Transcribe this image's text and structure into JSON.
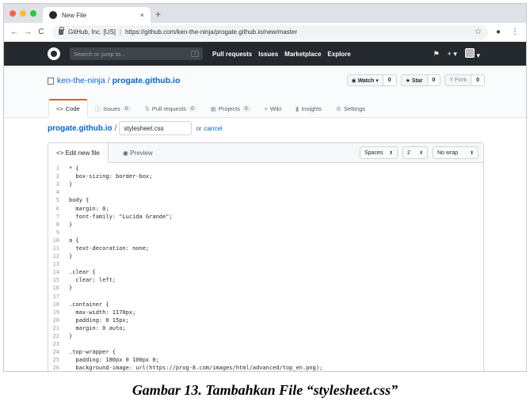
{
  "browser": {
    "tab_title": "New File",
    "tab_close": "×",
    "new_tab": "+",
    "back": "←",
    "forward": "→",
    "reload": "C",
    "ev_cert": "GitHub, Inc. [US]",
    "url": "https://github.com/ken-the-ninja/progate.github.io/new/master",
    "star": "☆",
    "menu": "⋮",
    "account": "●"
  },
  "github_header": {
    "search_placeholder": "Search or jump to...",
    "search_key": "/",
    "nav": [
      "Pull requests",
      "Issues",
      "Marketplace",
      "Explore"
    ],
    "bell": "🔔",
    "plus": "+ ▾",
    "avatar_caret": "▾"
  },
  "repo": {
    "owner": "ken-the-ninja",
    "separator": "/",
    "name": "progate.github.io",
    "watch_label": "◉ Watch ▾",
    "watch_count": "0",
    "star_label": "★ Star",
    "star_count": "0",
    "fork_label": "Y Fork",
    "fork_count": "0",
    "tabs": [
      {
        "icon": "<>",
        "label": "Code",
        "count": ""
      },
      {
        "icon": "ⓘ",
        "label": "Issues",
        "count": "0"
      },
      {
        "icon": "⇅",
        "label": "Pull requests",
        "count": "0"
      },
      {
        "icon": "▦",
        "label": "Projects",
        "count": "0"
      },
      {
        "icon": "≡",
        "label": "Wiki",
        "count": ""
      },
      {
        "icon": "▮",
        "label": "Insights",
        "count": ""
      },
      {
        "icon": "⚙",
        "label": "Settings",
        "count": ""
      }
    ]
  },
  "file": {
    "repo_link": "progate.github.io",
    "separator": "/",
    "filename": "stylesheet.css",
    "or_text": "or",
    "cancel": "cancel"
  },
  "editor": {
    "edit_tab": "<> Edit new file",
    "preview_tab": "◉ Preview",
    "indent_mode": "Spaces",
    "indent_size": "2",
    "wrap_mode": "No wrap",
    "select_arrow": "⬍",
    "lines": [
      "* {",
      "  box-sizing: border-box;",
      "}",
      "",
      "body {",
      "  margin: 0;",
      "  font-family: \"Lucida Grande\";",
      "}",
      "",
      "a {",
      "  text-decoration: none;",
      "}",
      "",
      ".clear {",
      "  clear: left;",
      "}",
      "",
      ".container {",
      "  max-width: 1170px;",
      "  padding: 0 15px;",
      "  margin: 0 auto;",
      "}",
      "",
      ".top-wrapper {",
      "  padding: 180px 0 100px 0;",
      "  background-image: url(https://prog-8.com/images/html/advanced/top_en.png);"
    ]
  },
  "caption": "Gambar 13. Tambahkan File “stylesheet.css”"
}
